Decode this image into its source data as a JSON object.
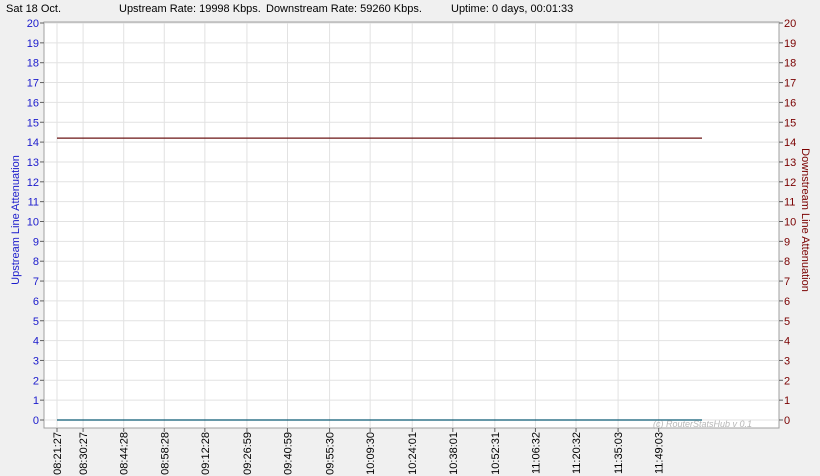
{
  "header": {
    "date": "Sat 18 Oct.",
    "upstream_rate": "Upstream Rate: 19998 Kbps.",
    "downstream_rate": "Downstream Rate: 59260 Kbps.",
    "uptime": "Uptime: 0 days, 00:01:33"
  },
  "watermark": "(c) RouterStatsHub v 0.1",
  "colors": {
    "upstream": "#1a1acc",
    "downstream": "#7a0000",
    "upstream_line": "#0b5a74",
    "downstream_line": "#6b1515",
    "grid": "#e2e2e2",
    "background": "#ffffff"
  },
  "chart_data": {
    "type": "line",
    "ylabel": "Upstream Line Attenuation",
    "ylabel_right": "Downstream Line Attenuation",
    "ylim": [
      0,
      20
    ],
    "y_ticks": [
      0,
      1,
      2,
      3,
      4,
      5,
      6,
      7,
      8,
      9,
      10,
      11,
      12,
      13,
      14,
      15,
      16,
      17,
      18,
      19,
      20
    ],
    "grid": true,
    "x_ticks": [
      "08:21:27",
      "08:30:27",
      "08:44:28",
      "08:58:28",
      "09:12:28",
      "09:26:59",
      "09:40:59",
      "09:55:30",
      "10:09:30",
      "10:24:01",
      "10:38:01",
      "10:52:31",
      "11:06:32",
      "11:20:32",
      "11:35:03",
      "11:49:03"
    ],
    "x_range": [
      "08:21:27",
      "12:04:00"
    ],
    "series": [
      {
        "axis": "left",
        "color": "upstream_line",
        "x": [
          "08:21:27",
          "12:04:00"
        ],
        "values": [
          0,
          0
        ]
      },
      {
        "axis": "right",
        "color": "downstream_line",
        "x": [
          "08:21:27",
          "12:04:00"
        ],
        "values": [
          14.2,
          14.2
        ]
      }
    ]
  }
}
